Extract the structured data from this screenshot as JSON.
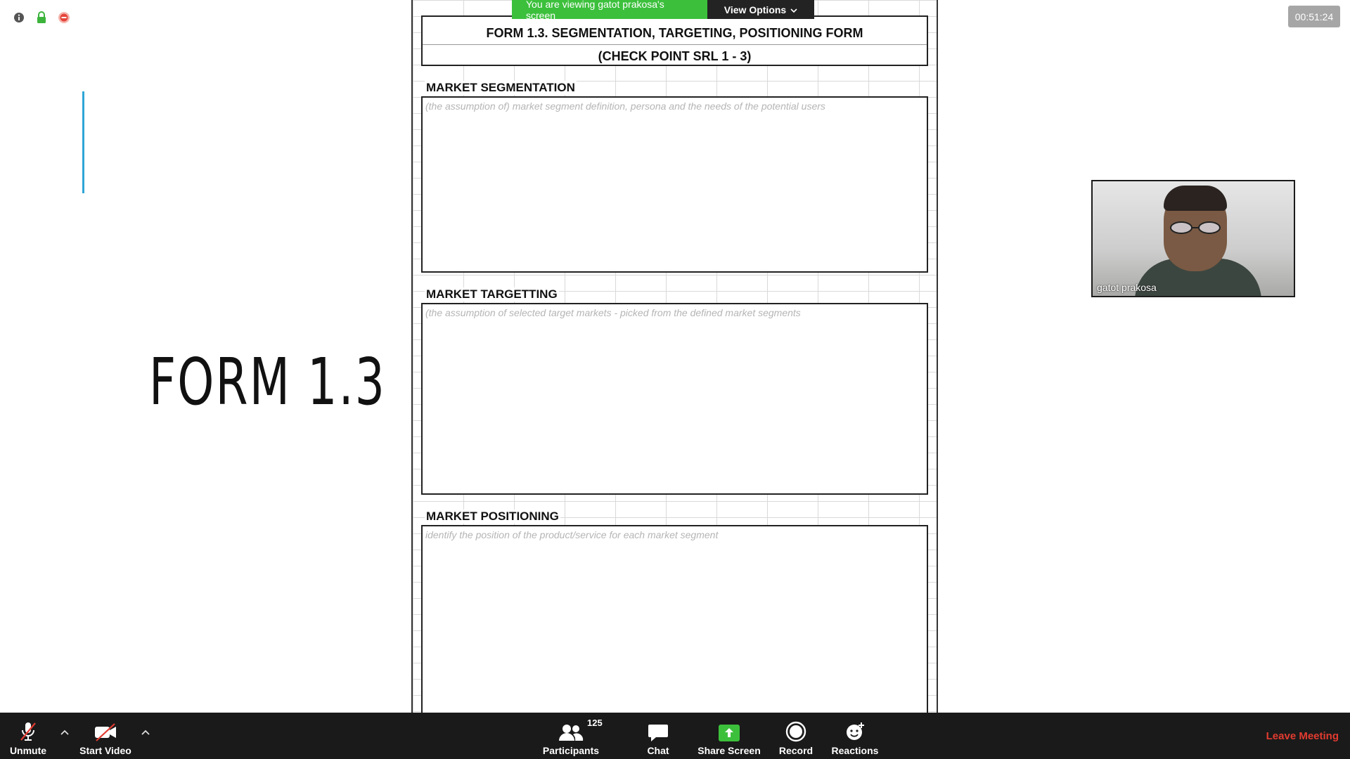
{
  "meeting": {
    "timer": "00:51:24",
    "share_banner": {
      "viewing_text": "You are viewing gatot prakosa's screen",
      "view_options_label": "View Options"
    }
  },
  "slide": {
    "title": "FORM 1.3"
  },
  "form": {
    "title_line1": "FORM 1.3. SEGMENTATION, TARGETING, POSITIONING FORM",
    "title_line2": "(CHECK POINT SRL 1 - 3)",
    "sections": [
      {
        "heading": "MARKET SEGMENTATION",
        "hint": "(the assumption of) market segment definition, persona and the needs of the potential users"
      },
      {
        "heading": "MARKET TARGETTING",
        "hint": "(the assumption of selected target markets - picked from the defined market segments"
      },
      {
        "heading": "MARKET POSITIONING",
        "hint": "identify the position of the product/service for each market segment"
      }
    ]
  },
  "participant_video": {
    "name": "gatot prakosa"
  },
  "toolbar": {
    "unmute_label": "Unmute",
    "start_video_label": "Start Video",
    "participants_label": "Participants",
    "participants_count": "125",
    "chat_label": "Chat",
    "share_screen_label": "Share Screen",
    "record_label": "Record",
    "reactions_label": "Reactions",
    "leave_label": "Leave Meeting"
  },
  "colors": {
    "share_green": "#3cc03c",
    "leave_red": "#e23b30",
    "slide_accent": "#2fa6d6"
  }
}
